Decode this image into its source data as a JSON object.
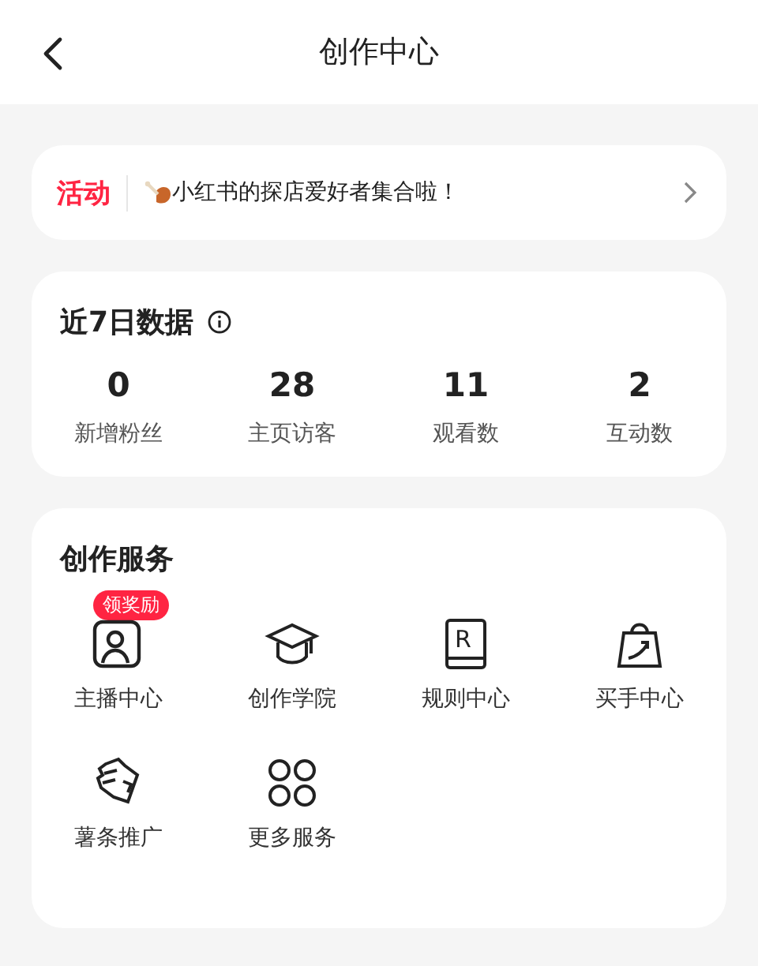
{
  "header": {
    "title": "创作中心"
  },
  "activity": {
    "tag": "活动",
    "text": "小红书的探店爱好者集合啦！"
  },
  "stats": {
    "title": "近7日数据",
    "items": [
      {
        "value": "0",
        "label": "新增粉丝"
      },
      {
        "value": "28",
        "label": "主页访客"
      },
      {
        "value": "11",
        "label": "观看数"
      },
      {
        "value": "2",
        "label": "互动数"
      }
    ]
  },
  "services": {
    "title": "创作服务",
    "items": [
      {
        "label": "主播中心",
        "badge": "领奖励"
      },
      {
        "label": "创作学院"
      },
      {
        "label": "规则中心",
        "glyph": "R"
      },
      {
        "label": "买手中心"
      },
      {
        "label": "薯条推广"
      },
      {
        "label": "更多服务"
      }
    ]
  }
}
